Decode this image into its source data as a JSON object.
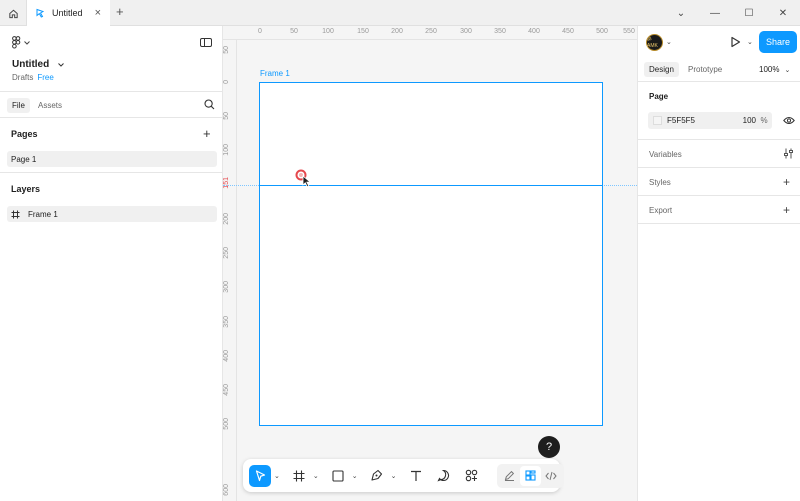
{
  "titlebar": {
    "tab_title": "Untitled",
    "close_glyph": "×",
    "new_tab_glyph": "+",
    "window_controls": [
      "⌄",
      "—",
      "☐",
      "✕"
    ]
  },
  "left_panel": {
    "file_name": "Untitled",
    "location": "Drafts",
    "plan_badge": "Free",
    "tabs": [
      "File",
      "Assets"
    ],
    "pages_title": "Pages",
    "pages": [
      "Page 1"
    ],
    "layers_title": "Layers",
    "layers": [
      "Frame 1"
    ]
  },
  "canvas": {
    "frame_label": "Frame 1",
    "ruler_top_ticks": [
      "0",
      "50",
      "100",
      "150",
      "200",
      "250",
      "300",
      "350",
      "400",
      "450",
      "500",
      "550"
    ],
    "ruler_left_ticks": [
      "50",
      "0",
      "50",
      "100",
      "151",
      "200",
      "250",
      "300",
      "350",
      "400",
      "450",
      "500",
      "600"
    ],
    "highlighted_tick": "151"
  },
  "toolbar": {
    "tools": [
      "move-tool",
      "frame-tool",
      "rectangle-tool",
      "pen-tool",
      "text-tool",
      "comment-tool",
      "actions-tool"
    ],
    "modes": [
      "draw-mode",
      "design-mode",
      "dev-mode"
    ]
  },
  "help_label": "?",
  "right_panel": {
    "avatar_text": "ॐ AMK",
    "share_label": "Share",
    "tabs": [
      "Design",
      "Prototype"
    ],
    "zoom": "100%",
    "page_section_title": "Page",
    "page_fill_hex": "F5F5F5",
    "page_fill_opacity": "100",
    "page_fill_unit": "%",
    "variables_title": "Variables",
    "styles_title": "Styles",
    "export_title": "Export"
  },
  "colors": {
    "accent": "#0d99ff",
    "canvas_bg": "#f5f5f5",
    "guide_highlight": "#e5484d"
  }
}
